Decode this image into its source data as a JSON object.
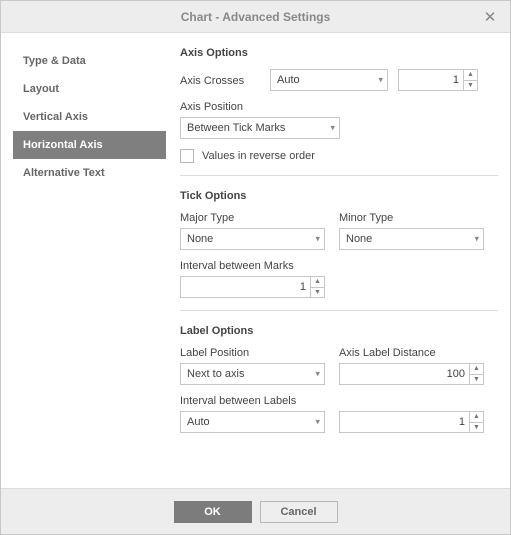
{
  "dialog": {
    "title": "Chart - Advanced Settings"
  },
  "sidebar": {
    "items": [
      {
        "label": "Type & Data"
      },
      {
        "label": "Layout"
      },
      {
        "label": "Vertical Axis"
      },
      {
        "label": "Horizontal Axis"
      },
      {
        "label": "Alternative Text"
      }
    ]
  },
  "axisOptions": {
    "title": "Axis Options",
    "crosses_label": "Axis Crosses",
    "crosses_value": "Auto",
    "crosses_num": "1",
    "position_label": "Axis Position",
    "position_value": "Between Tick Marks",
    "reverse_label": "Values in reverse order"
  },
  "tickOptions": {
    "title": "Tick Options",
    "major_label": "Major Type",
    "major_value": "None",
    "minor_label": "Minor Type",
    "minor_value": "None",
    "interval_label": "Interval between Marks",
    "interval_value": "1"
  },
  "labelOptions": {
    "title": "Label Options",
    "pos_label": "Label Position",
    "pos_value": "Next to axis",
    "dist_label": "Axis Label Distance",
    "dist_value": "100",
    "interval_label": "Interval between Labels",
    "interval_select": "Auto",
    "interval_value": "1"
  },
  "footer": {
    "ok": "OK",
    "cancel": "Cancel"
  }
}
